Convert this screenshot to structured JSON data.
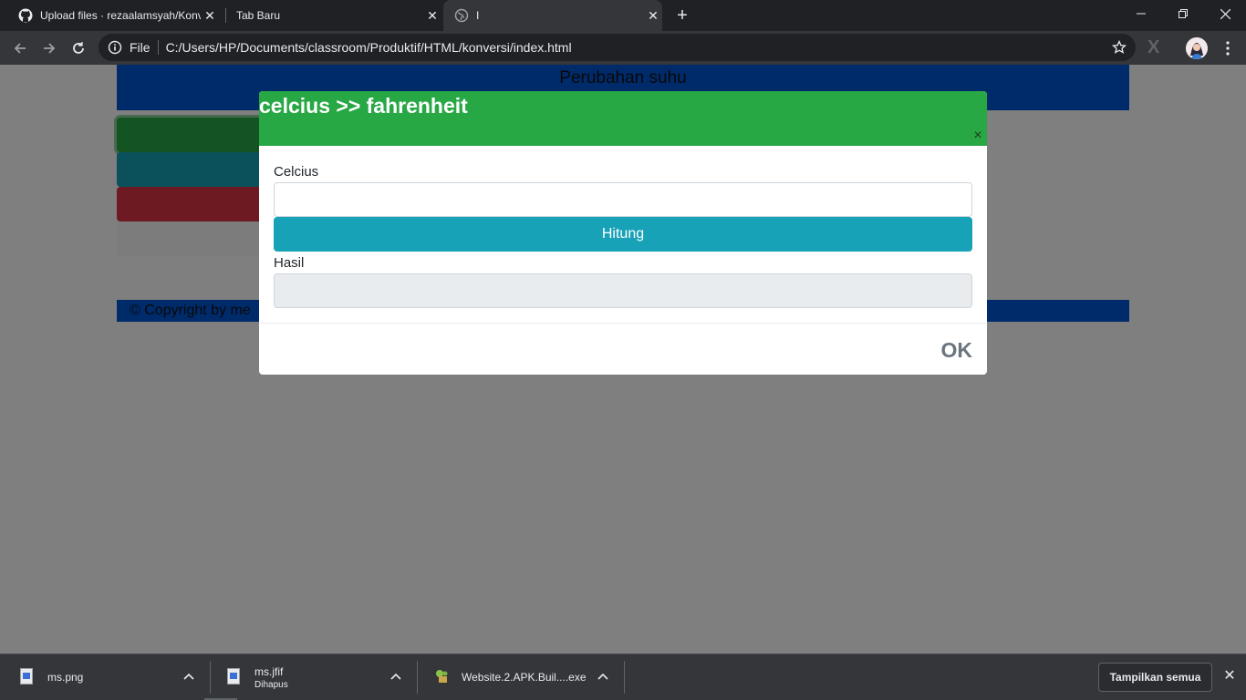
{
  "browser": {
    "tabs": [
      {
        "title": "Upload files · rezaalamsyah/Konv",
        "icon": "github-icon",
        "active": false
      },
      {
        "title": "Tab Baru",
        "icon": "",
        "active": false
      },
      {
        "title": "I",
        "icon": "globe-icon",
        "active": true
      }
    ],
    "new_tab": "+",
    "address": {
      "scheme": "File",
      "url": "C:/Users/HP/Documents/classroom/Produktif/HTML/konversi/index.html"
    },
    "colors": {
      "frame": "#202124",
      "toolbar": "#35363a"
    }
  },
  "page": {
    "header": "Perubahan suhu",
    "footer": "© Copyright by me",
    "colors": {
      "primary": "#0056d6",
      "success": "#28a745",
      "info": "#17a2b8",
      "danger": "#dc3545",
      "light": "#f8f9fa"
    }
  },
  "modal": {
    "title": "celcius >> fahrenheit",
    "close_glyph": "×",
    "input_label": "Celcius",
    "input_value": "",
    "button_label": "Hitung",
    "result_label": "Hasil",
    "result_value": "",
    "ok_label": "OK"
  },
  "downloads": {
    "items": [
      {
        "name": "ms.png",
        "status": "",
        "icon": "image-file-icon"
      },
      {
        "name": "ms.jfif",
        "status": "Dihapus",
        "icon": "image-file-icon"
      },
      {
        "name": "Website.2.APK.Buil....exe",
        "status": "",
        "icon": "installer-icon"
      }
    ],
    "show_all_label": "Tampilkan semua"
  }
}
